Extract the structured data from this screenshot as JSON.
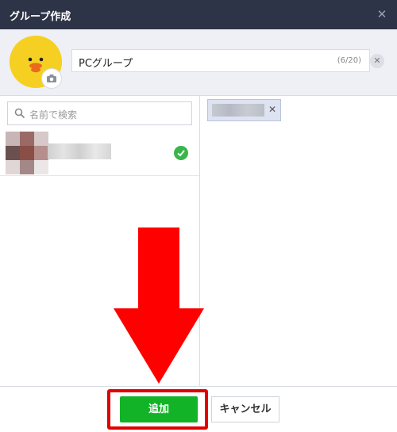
{
  "window": {
    "title": "グループ作成"
  },
  "group": {
    "name": "PCグループ",
    "name_count": "(6/20)"
  },
  "search": {
    "placeholder": "名前で検索"
  },
  "footer": {
    "add_label": "追加",
    "cancel_label": "キャンセル"
  },
  "colors": {
    "titlebar": "#2e3447",
    "accent_green": "#12b327",
    "check_green": "#3ab54a",
    "highlight_red": "#e00000"
  },
  "icons": [
    "close-icon",
    "camera-icon",
    "clear-icon",
    "search-icon",
    "check-icon",
    "remove-icon",
    "down-arrow-icon"
  ]
}
